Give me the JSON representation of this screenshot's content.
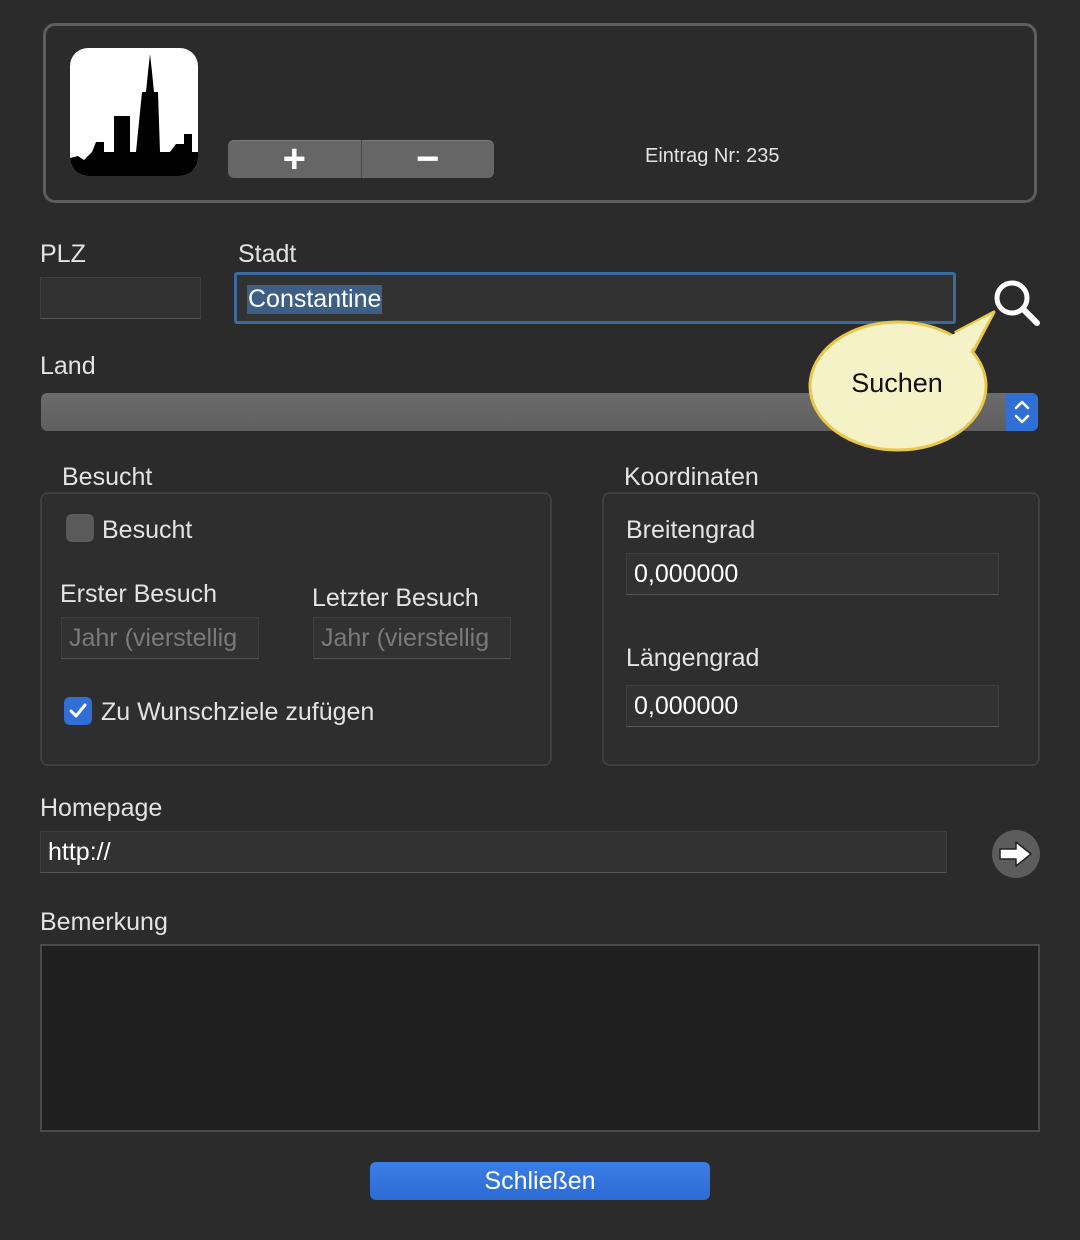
{
  "header": {
    "entry_label": "Eintrag Nr: 235",
    "add_symbol": "+",
    "remove_symbol": "−"
  },
  "fields": {
    "plz": {
      "label": "PLZ",
      "value": ""
    },
    "stadt": {
      "label": "Stadt",
      "value": "Constantine"
    },
    "land": {
      "label": "Land",
      "selected": ""
    }
  },
  "tooltip": {
    "text": "Suchen"
  },
  "visited": {
    "group_title": "Besucht",
    "checkbox_label": "Besucht",
    "checked": false,
    "first_visit_label": "Erster Besuch",
    "last_visit_label": "Letzter Besuch",
    "first_visit_placeholder": "Jahr (vierstellig",
    "last_visit_placeholder": "Jahr (vierstellig",
    "wishlist_label": "Zu Wunschziele zufügen",
    "wishlist_checked": true
  },
  "coordinates": {
    "group_title": "Koordinaten",
    "latitude_label": "Breitengrad",
    "latitude_value": "0,000000",
    "longitude_label": "Längengrad",
    "longitude_value": "0,000000"
  },
  "homepage": {
    "label": "Homepage",
    "value": "http://"
  },
  "notes": {
    "label": "Bemerkung",
    "value": ""
  },
  "footer": {
    "close_label": "Schließen"
  },
  "colors": {
    "accent": "#2f6fd6",
    "background": "#2b2b2b",
    "tooltip_fill": "#f6f2c8",
    "tooltip_border": "#e8c84a"
  }
}
